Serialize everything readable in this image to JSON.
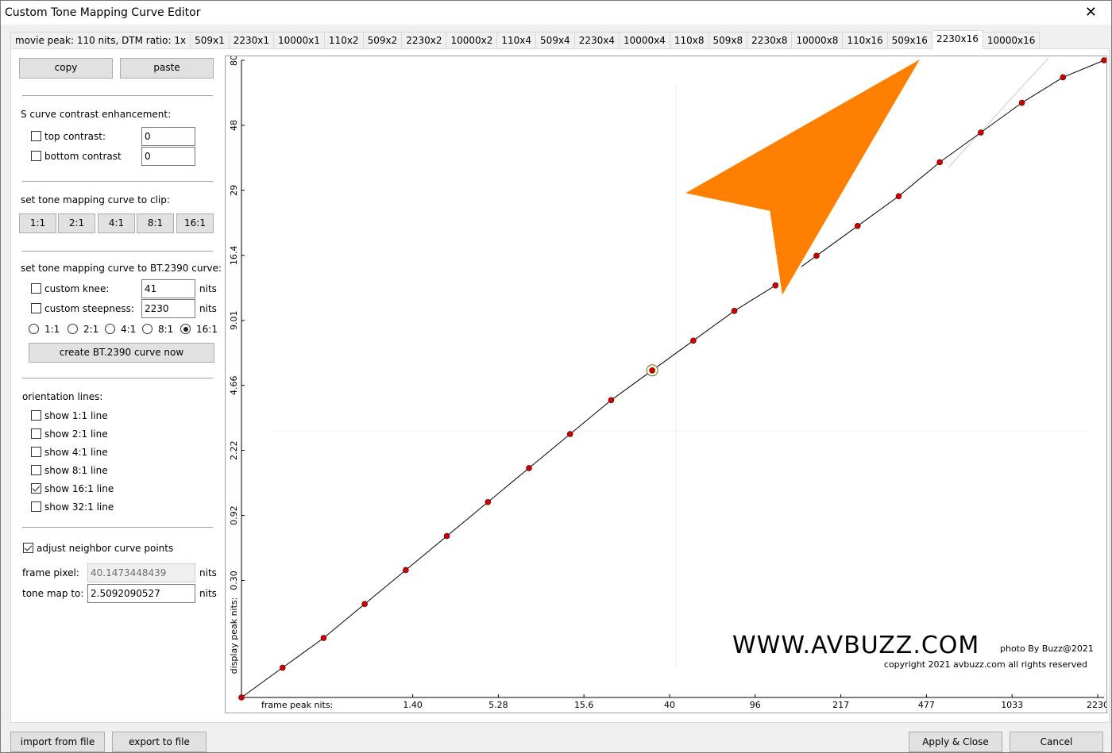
{
  "window": {
    "title": "Custom Tone Mapping Curve Editor",
    "close_glyph": "✕"
  },
  "tabs": [
    "movie peak: 110 nits, DTM ratio: 1x",
    "509x1",
    "2230x1",
    "10000x1",
    "110x2",
    "509x2",
    "2230x2",
    "10000x2",
    "110x4",
    "509x4",
    "2230x4",
    "10000x4",
    "110x8",
    "509x8",
    "2230x8",
    "10000x8",
    "110x16",
    "509x16",
    "2230x16",
    "10000x16"
  ],
  "active_tab_index": 18,
  "panel": {
    "copy_label": "copy",
    "paste_label": "paste",
    "s_curve_heading": "S curve contrast enhancement:",
    "top_contrast_label": "top contrast:",
    "top_contrast_value": "0",
    "bottom_contrast_label": "bottom contrast",
    "bottom_contrast_value": "0",
    "clip_heading": "set tone mapping curve to clip:",
    "clip_buttons": [
      "1:1",
      "2:1",
      "4:1",
      "8:1",
      "16:1"
    ],
    "bt2390_heading": "set tone mapping curve to BT.2390 curve:",
    "custom_knee_label": "custom knee:",
    "custom_knee_value": "41",
    "custom_steepness_label": "custom steepness:",
    "custom_steepness_value": "2230",
    "nits_unit": "nits",
    "ratio_options": [
      "1:1",
      "2:1",
      "4:1",
      "8:1",
      "16:1"
    ],
    "ratio_selected_index": 4,
    "create_bt2390_label": "create BT.2390 curve now",
    "orientation_heading": "orientation lines:",
    "orientation_lines": [
      {
        "label": "show 1:1 line",
        "checked": false
      },
      {
        "label": "show 2:1 line",
        "checked": false
      },
      {
        "label": "show 4:1 line",
        "checked": false
      },
      {
        "label": "show 8:1 line",
        "checked": false
      },
      {
        "label": "show 16:1 line",
        "checked": true
      },
      {
        "label": "show 32:1 line",
        "checked": false
      }
    ],
    "adjust_neighbor_label": "adjust neighbor curve points",
    "adjust_neighbor_checked": true,
    "frame_pixel_label": "frame pixel:",
    "frame_pixel_value": "40.1473448439",
    "tone_map_label": "tone map to:",
    "tone_map_value": "2.5092090527"
  },
  "footer": {
    "import_label": "import from file",
    "export_label": "export to file",
    "apply_label": "Apply & Close",
    "cancel_label": "Cancel"
  },
  "watermark": {
    "site": "WWW.AVBUZZ.COM",
    "photo_credit": "photo By Buzz@2021",
    "copyright": "copyright 2021 avbuzz.com all rights reserved"
  },
  "colors": {
    "arrow": "#ff8000",
    "point": "#cc0000",
    "curve": "#000000",
    "guide": "#cccccc"
  },
  "chart_data": {
    "type": "line",
    "xlabel": "frame peak nits:",
    "ylabel": "display peak nits:",
    "x_tick_labels": [
      "1.40",
      "5.28",
      "15.6",
      "40",
      "96",
      "217",
      "477",
      "1033",
      "2230"
    ],
    "y_tick_labels": [
      "0.30",
      "0.92",
      "2.22",
      "4.66",
      "9.01",
      "16.4",
      "29",
      "48",
      "80"
    ],
    "selected_point": {
      "x": 40.1473448439,
      "y": 2.5092090527
    },
    "series": [
      {
        "values": [
          0.0,
          0.07,
          0.14,
          0.22,
          0.3,
          0.38,
          0.46,
          0.54,
          0.62,
          0.7,
          0.77,
          0.84,
          0.91,
          0.97,
          1.04,
          1.11,
          1.18,
          1.26,
          1.33,
          1.4,
          1.46,
          1.5
        ]
      }
    ]
  }
}
